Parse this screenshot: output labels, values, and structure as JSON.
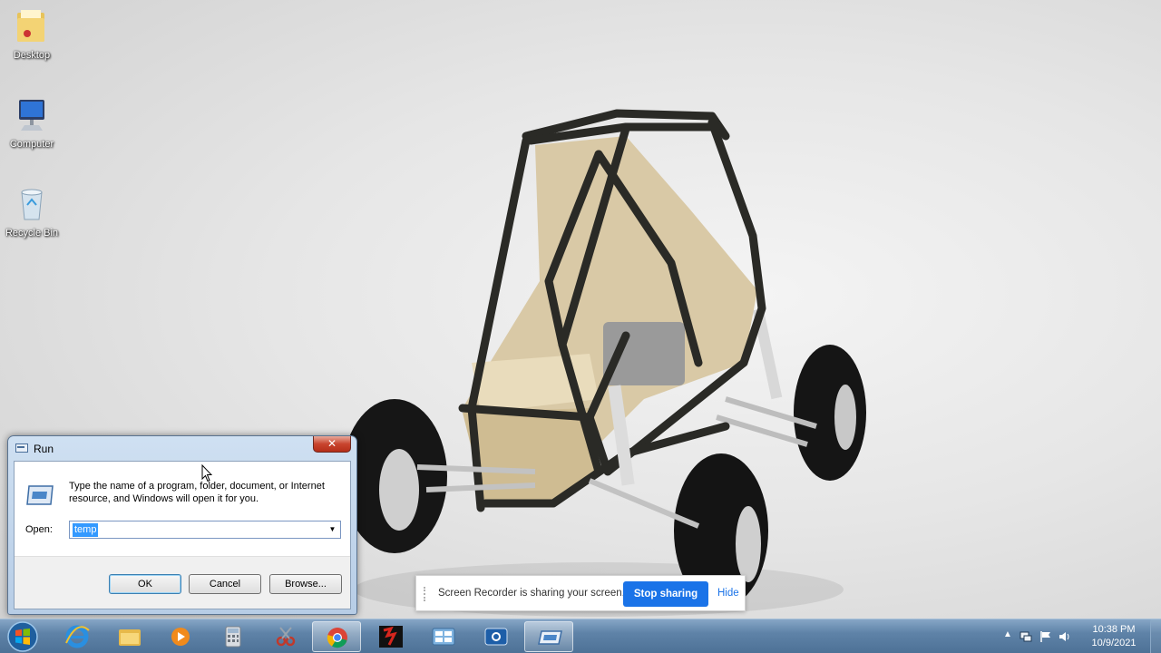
{
  "desktop": {
    "icons": [
      {
        "label": "Desktop",
        "icon": "folder-icon"
      },
      {
        "label": "Computer",
        "icon": "computer-icon"
      },
      {
        "label": "Recycle Bin",
        "icon": "recycle-bin-icon"
      }
    ]
  },
  "run_dialog": {
    "title": "Run",
    "close_label": "✕",
    "description": "Type the name of a program, folder, document, or Internet resource, and Windows will open it for you.",
    "open_label": "Open:",
    "open_value": "temp",
    "ok_label": "OK",
    "cancel_label": "Cancel",
    "browse_label": "Browse..."
  },
  "share_bar": {
    "message": "Screen Recorder is sharing your screen.",
    "stop_label": "Stop sharing",
    "hide_label": "Hide",
    "accent": "#1a73e8"
  },
  "taskbar": {
    "items": [
      {
        "icon": "internet-explorer-icon"
      },
      {
        "icon": "file-explorer-icon"
      },
      {
        "icon": "media-player-icon"
      },
      {
        "icon": "calculator-icon"
      },
      {
        "icon": "snipping-tool-icon"
      },
      {
        "icon": "chrome-icon",
        "active": true
      },
      {
        "icon": "solidworks-icon"
      },
      {
        "icon": "control-panel-icon"
      },
      {
        "icon": "screen-recorder-icon"
      },
      {
        "icon": "run-icon"
      }
    ],
    "clock": {
      "time": "10:38 PM",
      "date": "10/9/2021"
    }
  }
}
